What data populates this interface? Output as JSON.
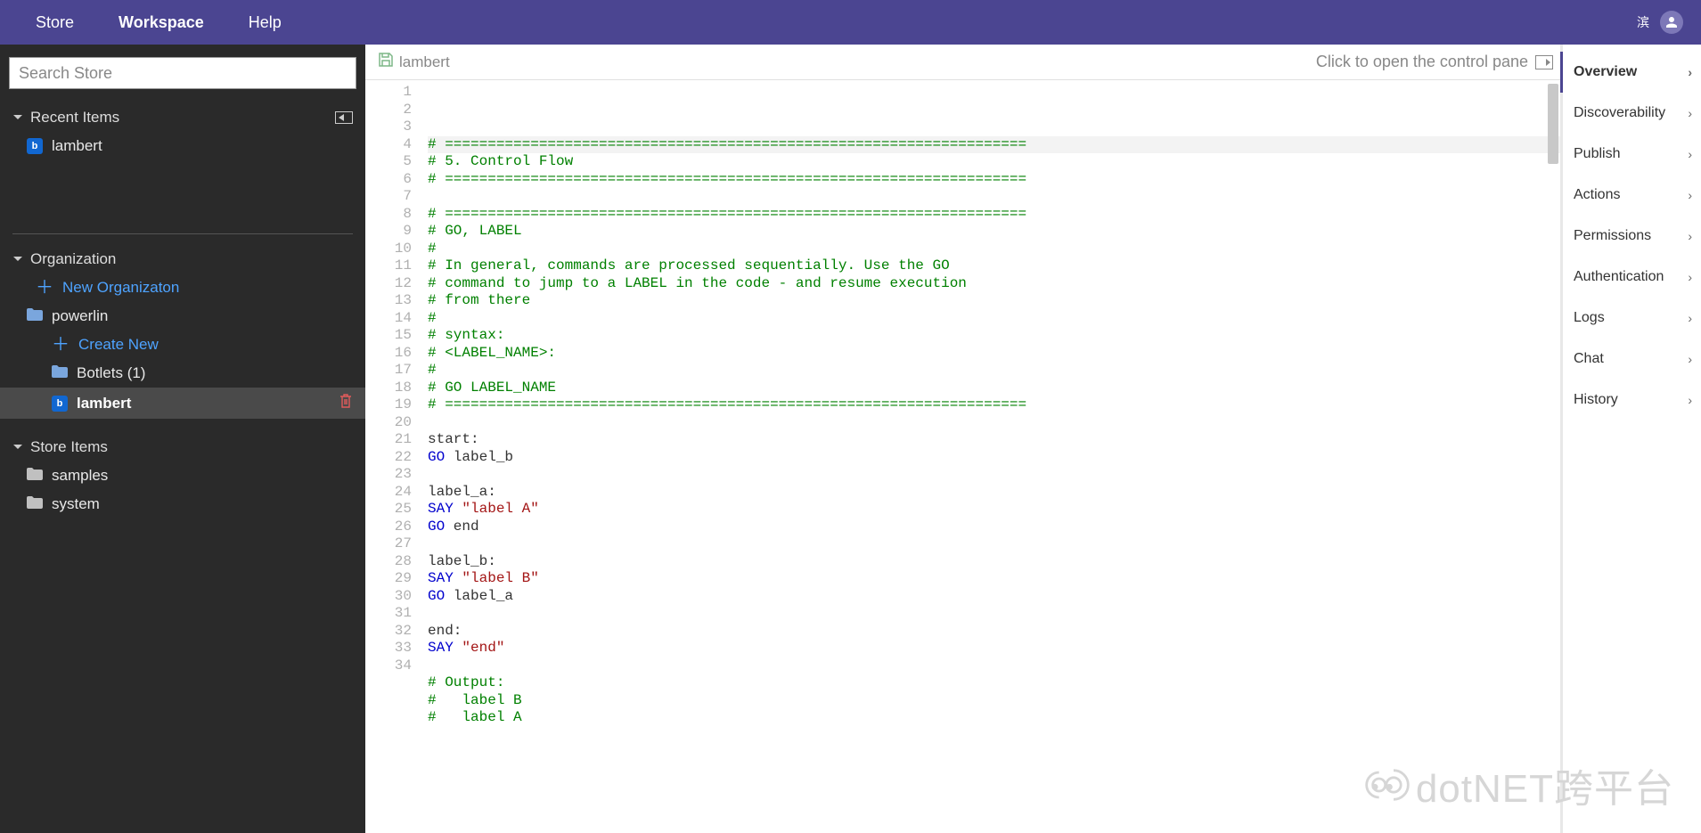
{
  "topnav": {
    "store": "Store",
    "workspace": "Workspace",
    "help": "Help"
  },
  "user": {
    "cjk": "滨"
  },
  "search": {
    "placeholder": "Search Store"
  },
  "recent": {
    "header": "Recent Items",
    "items": [
      {
        "label": "lambert"
      }
    ]
  },
  "org": {
    "header": "Organization",
    "new_org": "New Organizaton",
    "folder": "powerlin",
    "create_new": "Create New",
    "botlets": "Botlets (1)",
    "selected": "lambert"
  },
  "store": {
    "header": "Store Items",
    "samples": "samples",
    "system": "system"
  },
  "tab": {
    "filename": "lambert",
    "hint": "Click to open the control pane"
  },
  "rightpane": [
    "Overview",
    "Discoverability",
    "Publish",
    "Actions",
    "Permissions",
    "Authentication",
    "Logs",
    "Chat",
    "History"
  ],
  "watermark": "dotNET跨平台",
  "code": [
    {
      "n": 1,
      "t": [
        [
          "comment",
          "# ===================================================================="
        ]
      ]
    },
    {
      "n": 2,
      "t": [
        [
          "comment",
          "# 5. Control Flow"
        ]
      ]
    },
    {
      "n": 3,
      "t": [
        [
          "comment",
          "# ===================================================================="
        ]
      ]
    },
    {
      "n": 4,
      "t": []
    },
    {
      "n": 5,
      "t": [
        [
          "comment",
          "# ===================================================================="
        ]
      ]
    },
    {
      "n": 6,
      "t": [
        [
          "comment",
          "# GO, LABEL"
        ]
      ]
    },
    {
      "n": 7,
      "t": [
        [
          "comment",
          "#"
        ]
      ]
    },
    {
      "n": 8,
      "t": [
        [
          "comment",
          "# In general, commands are processed sequentially. Use the GO"
        ]
      ]
    },
    {
      "n": 9,
      "t": [
        [
          "comment",
          "# command to jump to a LABEL in the code - and resume execution"
        ]
      ]
    },
    {
      "n": 10,
      "t": [
        [
          "comment",
          "# from there"
        ]
      ]
    },
    {
      "n": 11,
      "t": [
        [
          "comment",
          "#"
        ]
      ]
    },
    {
      "n": 12,
      "t": [
        [
          "comment",
          "# syntax:"
        ]
      ]
    },
    {
      "n": 13,
      "t": [
        [
          "comment",
          "# <LABEL_NAME>:"
        ]
      ]
    },
    {
      "n": 14,
      "t": [
        [
          "comment",
          "#"
        ]
      ]
    },
    {
      "n": 15,
      "t": [
        [
          "comment",
          "# GO LABEL_NAME"
        ]
      ]
    },
    {
      "n": 16,
      "t": [
        [
          "comment",
          "# ===================================================================="
        ]
      ]
    },
    {
      "n": 17,
      "t": []
    },
    {
      "n": 18,
      "t": [
        [
          "ident",
          "start:"
        ]
      ]
    },
    {
      "n": 19,
      "t": [
        [
          "kw",
          "GO"
        ],
        [
          "ident",
          " label_b"
        ]
      ]
    },
    {
      "n": 20,
      "t": []
    },
    {
      "n": 21,
      "t": [
        [
          "ident",
          "label_a:"
        ]
      ]
    },
    {
      "n": 22,
      "t": [
        [
          "kw",
          "SAY"
        ],
        [
          "ident",
          " "
        ],
        [
          "str",
          "\"label A\""
        ]
      ]
    },
    {
      "n": 23,
      "t": [
        [
          "kw",
          "GO"
        ],
        [
          "ident",
          " end"
        ]
      ]
    },
    {
      "n": 24,
      "t": []
    },
    {
      "n": 25,
      "t": [
        [
          "ident",
          "label_b:"
        ]
      ]
    },
    {
      "n": 26,
      "t": [
        [
          "kw",
          "SAY"
        ],
        [
          "ident",
          " "
        ],
        [
          "str",
          "\"label B\""
        ]
      ]
    },
    {
      "n": 27,
      "t": [
        [
          "kw",
          "GO"
        ],
        [
          "ident",
          " label_a"
        ]
      ]
    },
    {
      "n": 28,
      "t": []
    },
    {
      "n": 29,
      "t": [
        [
          "ident",
          "end:"
        ]
      ]
    },
    {
      "n": 30,
      "t": [
        [
          "kw",
          "SAY"
        ],
        [
          "ident",
          " "
        ],
        [
          "str",
          "\"end\""
        ]
      ]
    },
    {
      "n": 31,
      "t": []
    },
    {
      "n": 32,
      "t": [
        [
          "comment",
          "# Output:"
        ]
      ]
    },
    {
      "n": 33,
      "t": [
        [
          "comment",
          "#   label B"
        ]
      ]
    },
    {
      "n": 34,
      "t": [
        [
          "comment",
          "#   label A"
        ]
      ]
    }
  ]
}
